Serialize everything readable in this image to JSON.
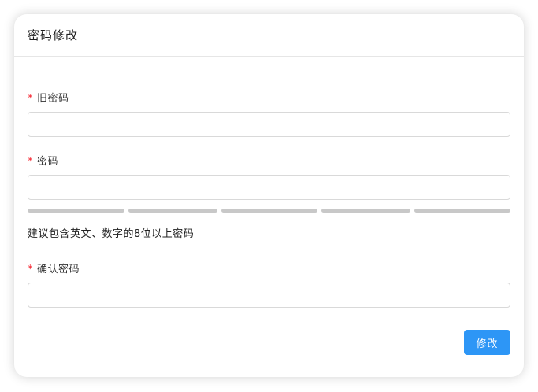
{
  "dialog": {
    "title": "密码修改"
  },
  "form": {
    "required_mark": "*",
    "old_password": {
      "label": "旧密码",
      "value": "",
      "placeholder": ""
    },
    "new_password": {
      "label": "密码",
      "value": "",
      "placeholder": ""
    },
    "strength_meter": {
      "segments": 5,
      "filled": 0
    },
    "hint": "建议包含英文、数字的8位以上密码",
    "confirm_password": {
      "label": "确认密码",
      "value": "",
      "placeholder": ""
    },
    "submit_label": "修改"
  },
  "colors": {
    "accent": "#2d96f6",
    "required": "#f5222d",
    "strength_empty": "#c8c8c8"
  }
}
